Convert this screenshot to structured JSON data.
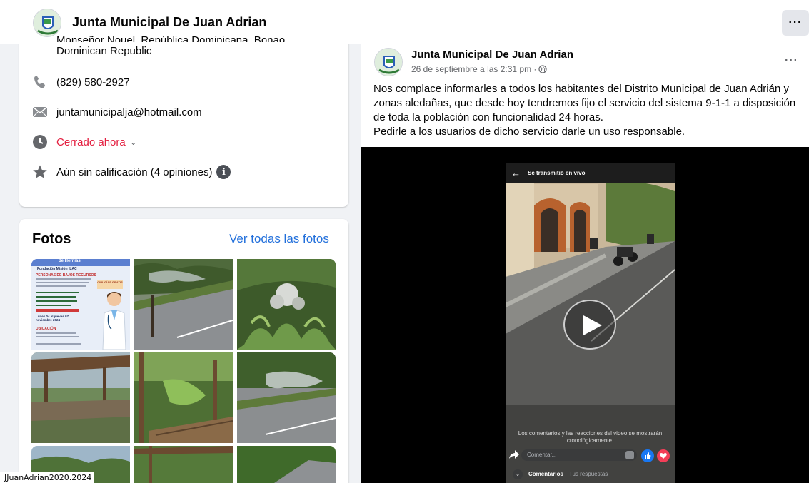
{
  "header": {
    "page_name": "Junta Municipal De Juan Adrian",
    "more_label": "···"
  },
  "intro": {
    "address_partial": "Monseñor Nouel, República Dominicana, Bonao,",
    "address_country": "Dominican Republic",
    "phone": "(829) 580-2927",
    "email": "juntamunicipalja@hotmail.com",
    "hours_status": "Cerrado ahora",
    "rating": "Aún sin calificación (4 opiniones)",
    "info_glyph": "i"
  },
  "photos": {
    "title": "Fotos",
    "see_all": "Ver todas las fotos",
    "flyer": {
      "heading": "de Hernias",
      "org": "Fundación Misión ILAC",
      "section1": "PERSONAS DE BAJOS RECURSOS",
      "badge": "CIRUGÍAS GRATIS",
      "dates": "Lunes 04 al jueves 07 noviembre 2024",
      "section2": "UBICACIÓN"
    }
  },
  "post": {
    "author": "Junta Municipal De Juan Adrian",
    "date": "26 de septiembre a las 2:31 pm ·",
    "more_label": "···",
    "paragraphs": [
      "Nos complace informarles a todos los habitantes del Distrito Municipal de Juan Adrián y zonas aledañas, que desde hoy tendremos fijo el servicio del sistema 9-1-1 a disposición de toda la población con funcionalidad 24 horas.",
      "Pedirle a los usuarios de dicho servicio darle un uso responsable."
    ]
  },
  "video": {
    "status": "Se transmitió en vivo",
    "back_glyph": "←",
    "caption": "Los comentarios y las reacciones del video se mostrarán cronológicamente.",
    "comment_placeholder": "Comentar...",
    "tab_comments": "Comentarios",
    "tab_replies": "Tus respuestas",
    "down_glyph": "⌄"
  },
  "watermark": "JJuanAdrian2020.2024",
  "colors": {
    "link": "#216fdb",
    "closed": "#e41e3f",
    "like": "#1877f2",
    "love": "#f33e58"
  }
}
